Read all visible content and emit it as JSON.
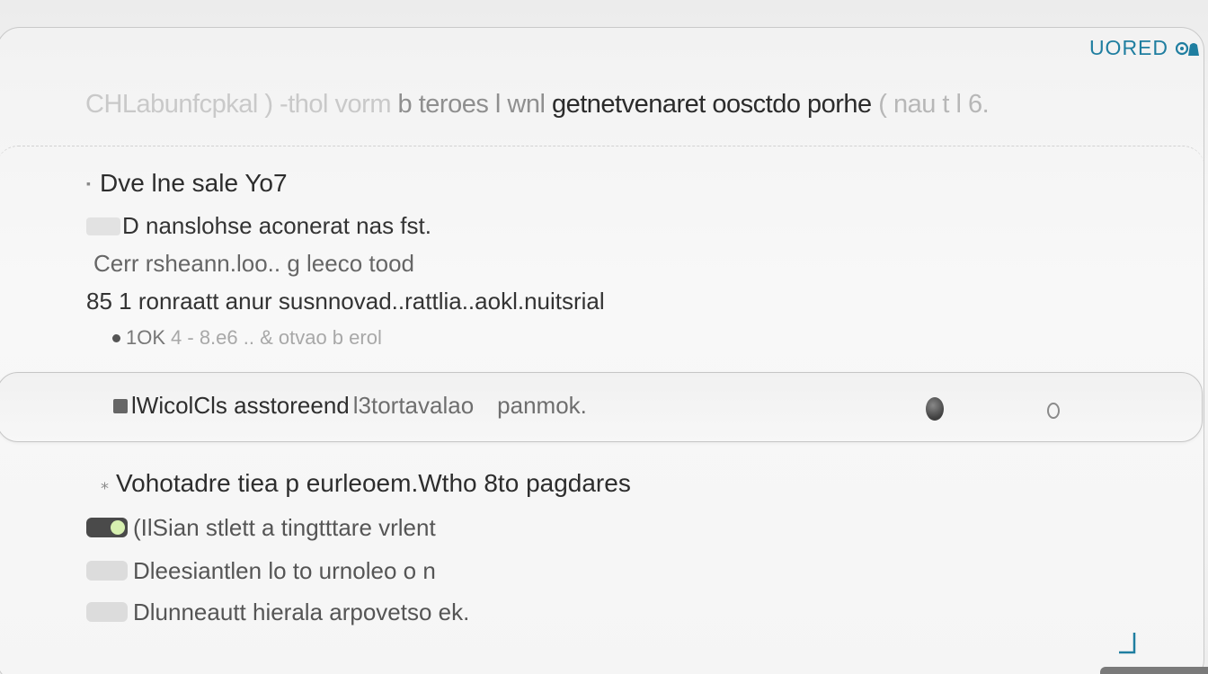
{
  "header": {
    "brand_text": "UORED",
    "brand_icon": "cloud-bell-icon",
    "brand_color": "#1f7ea0",
    "headline_fade": "CHLabunfcpkal ) -thol vorm",
    "headline_mid": "b teroes l wnl",
    "headline_main": "getnetvenaret oosctdo porhe",
    "headline_tail": "( nau t l 6."
  },
  "section1": {
    "title": "Dve lne sale Yo7",
    "items": [
      {
        "label": "D nanslohse aconerat nas fst.",
        "icon": "checkbox-icon"
      },
      {
        "label": "Cerr rsheann.loo.. g leeco tood"
      },
      {
        "label": "85 1 ronraatt anur susnnovad..rattlia..aokl.nuitsrial"
      }
    ],
    "sub_row": {
      "value": "1OK",
      "text": "4 - 8.e6 .. & otvao b erol"
    }
  },
  "highlight": {
    "label_main": "lWicolCls asstoreend",
    "label_grey": "l3tortavalao",
    "label_end": "panmok.",
    "knob_icon": "knob-icon",
    "ring_icon": "ring-icon"
  },
  "section2": {
    "title": "Vohotadre tiea p eurleoem.Wtho 8to pagdares",
    "options": [
      {
        "label": "(IlSian stlett a tingtttare vrlent",
        "state": "on"
      },
      {
        "label": "Dleesiantlen lo to urnoleo o n",
        "state": "off"
      },
      {
        "label": "Dlunneautt hierala arpovetso ek.",
        "state": "off"
      }
    ]
  },
  "footer": {
    "corner_icon": "resize-corner-icon"
  }
}
